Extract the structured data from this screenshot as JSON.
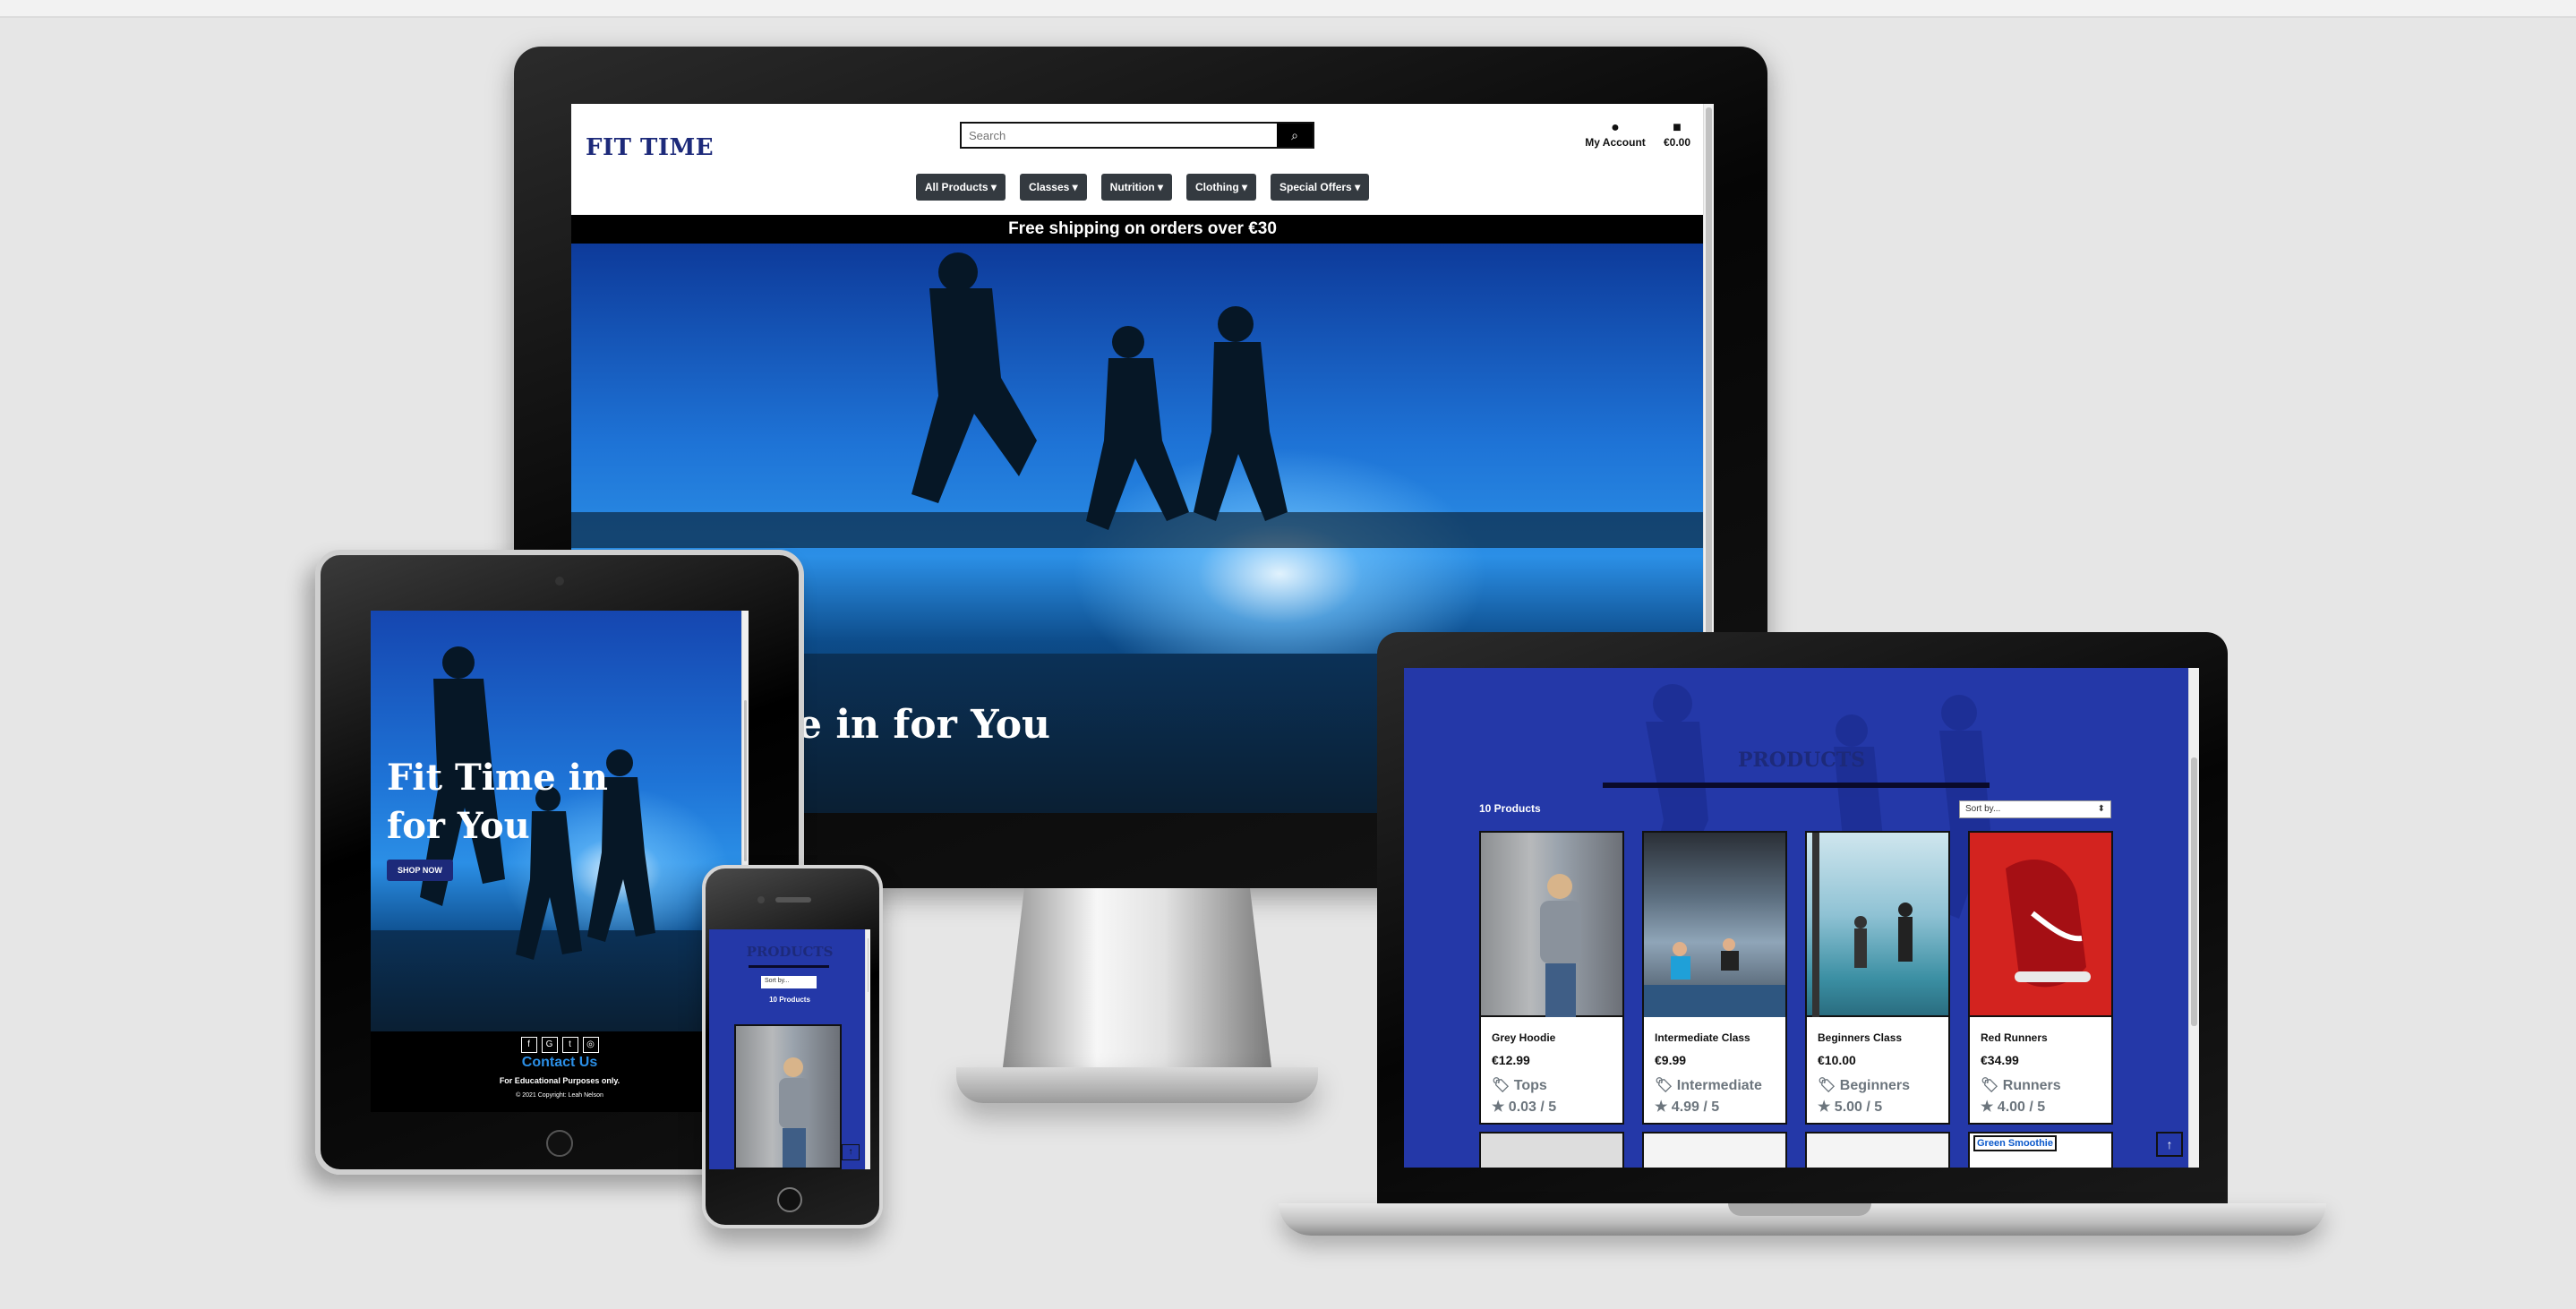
{
  "site": {
    "logo": "FIT TIME",
    "search_placeholder": "Search",
    "account_label": "My Account",
    "cart_total": "€0.00",
    "menu": [
      "All Products ▾",
      "Classes ▾",
      "Nutrition ▾",
      "Clothing ▾",
      "Special Offers ▾"
    ],
    "banner": "Free shipping on orders over €30",
    "hero_title_desktop": "e in for You",
    "hero_title_tablet_line1": "Fit Time in",
    "hero_title_tablet_line2": "for You",
    "shop_button": "SHOP NOW"
  },
  "products_page": {
    "title": "PRODUCTS",
    "count": "10 Products",
    "sort_placeholder": "Sort by...",
    "products": [
      {
        "name": "Grey Hoodie",
        "price": "€12.99",
        "category": "Tops",
        "rating": "0.03 / 5"
      },
      {
        "name": "Intermediate Class",
        "price": "€9.99",
        "category": "Intermediate",
        "rating": "4.99 / 5"
      },
      {
        "name": "Beginners Class",
        "price": "€10.00",
        "category": "Beginners",
        "rating": "5.00 / 5"
      },
      {
        "name": "Red Runners",
        "price": "€34.99",
        "category": "Runners",
        "rating": "4.00 / 5"
      }
    ],
    "broken_image_alt": "Green Smoothie",
    "back_to_top": "↑"
  },
  "footer": {
    "social": [
      "f",
      "G",
      "t",
      "◎"
    ],
    "contact": "Contact Us",
    "edu_note": "For Educational Purposes only.",
    "copyright": "© 2021 Copyright: Leah Nelson"
  }
}
